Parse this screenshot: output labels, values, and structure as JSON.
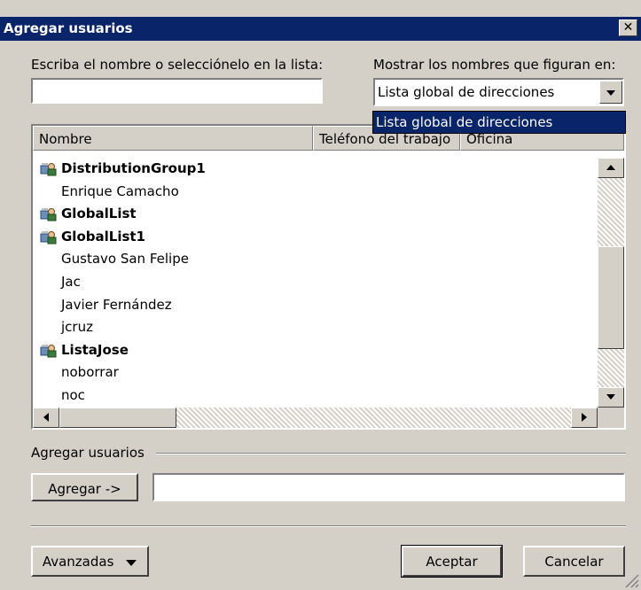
{
  "window": {
    "title": "Agregar usuarios",
    "close_label": "✕"
  },
  "search": {
    "label": "Escriba el nombre o selecciónelo en la lista:",
    "value": ""
  },
  "address_book": {
    "label": "Mostrar los nombres que figuran en:",
    "selected": "Lista global de direcciones",
    "highlighted_option": "Lista global de direcciones"
  },
  "columns": [
    "Nombre",
    "Teléfono del trabajo",
    "Oficina"
  ],
  "entries": [
    {
      "name": "DistributionGroup1",
      "is_group": true,
      "icon": "group-icon"
    },
    {
      "name": "Enrique Camacho",
      "is_group": false
    },
    {
      "name": "GlobalList",
      "is_group": true,
      "icon": "group-icon"
    },
    {
      "name": "GlobalList1",
      "is_group": true,
      "icon": "group-icon"
    },
    {
      "name": "Gustavo San Felipe",
      "is_group": false
    },
    {
      "name": "Jac",
      "is_group": false
    },
    {
      "name": "Javier Fernández",
      "is_group": false
    },
    {
      "name": "jcruz",
      "is_group": false
    },
    {
      "name": "ListaJose",
      "is_group": true,
      "icon": "group-icon"
    },
    {
      "name": "noborrar",
      "is_group": false
    },
    {
      "name": "noc",
      "is_group": false
    }
  ],
  "add_section": {
    "label": "Agregar usuarios",
    "add_button": "Agregar ->",
    "value": ""
  },
  "footer": {
    "advanced_button": "Avanzadas",
    "ok_button": "Aceptar",
    "cancel_button": "Cancelar"
  },
  "colors": {
    "titlebar": "#0a246a",
    "face": "#d4d0c8",
    "highlight_text": "#ffffff"
  }
}
